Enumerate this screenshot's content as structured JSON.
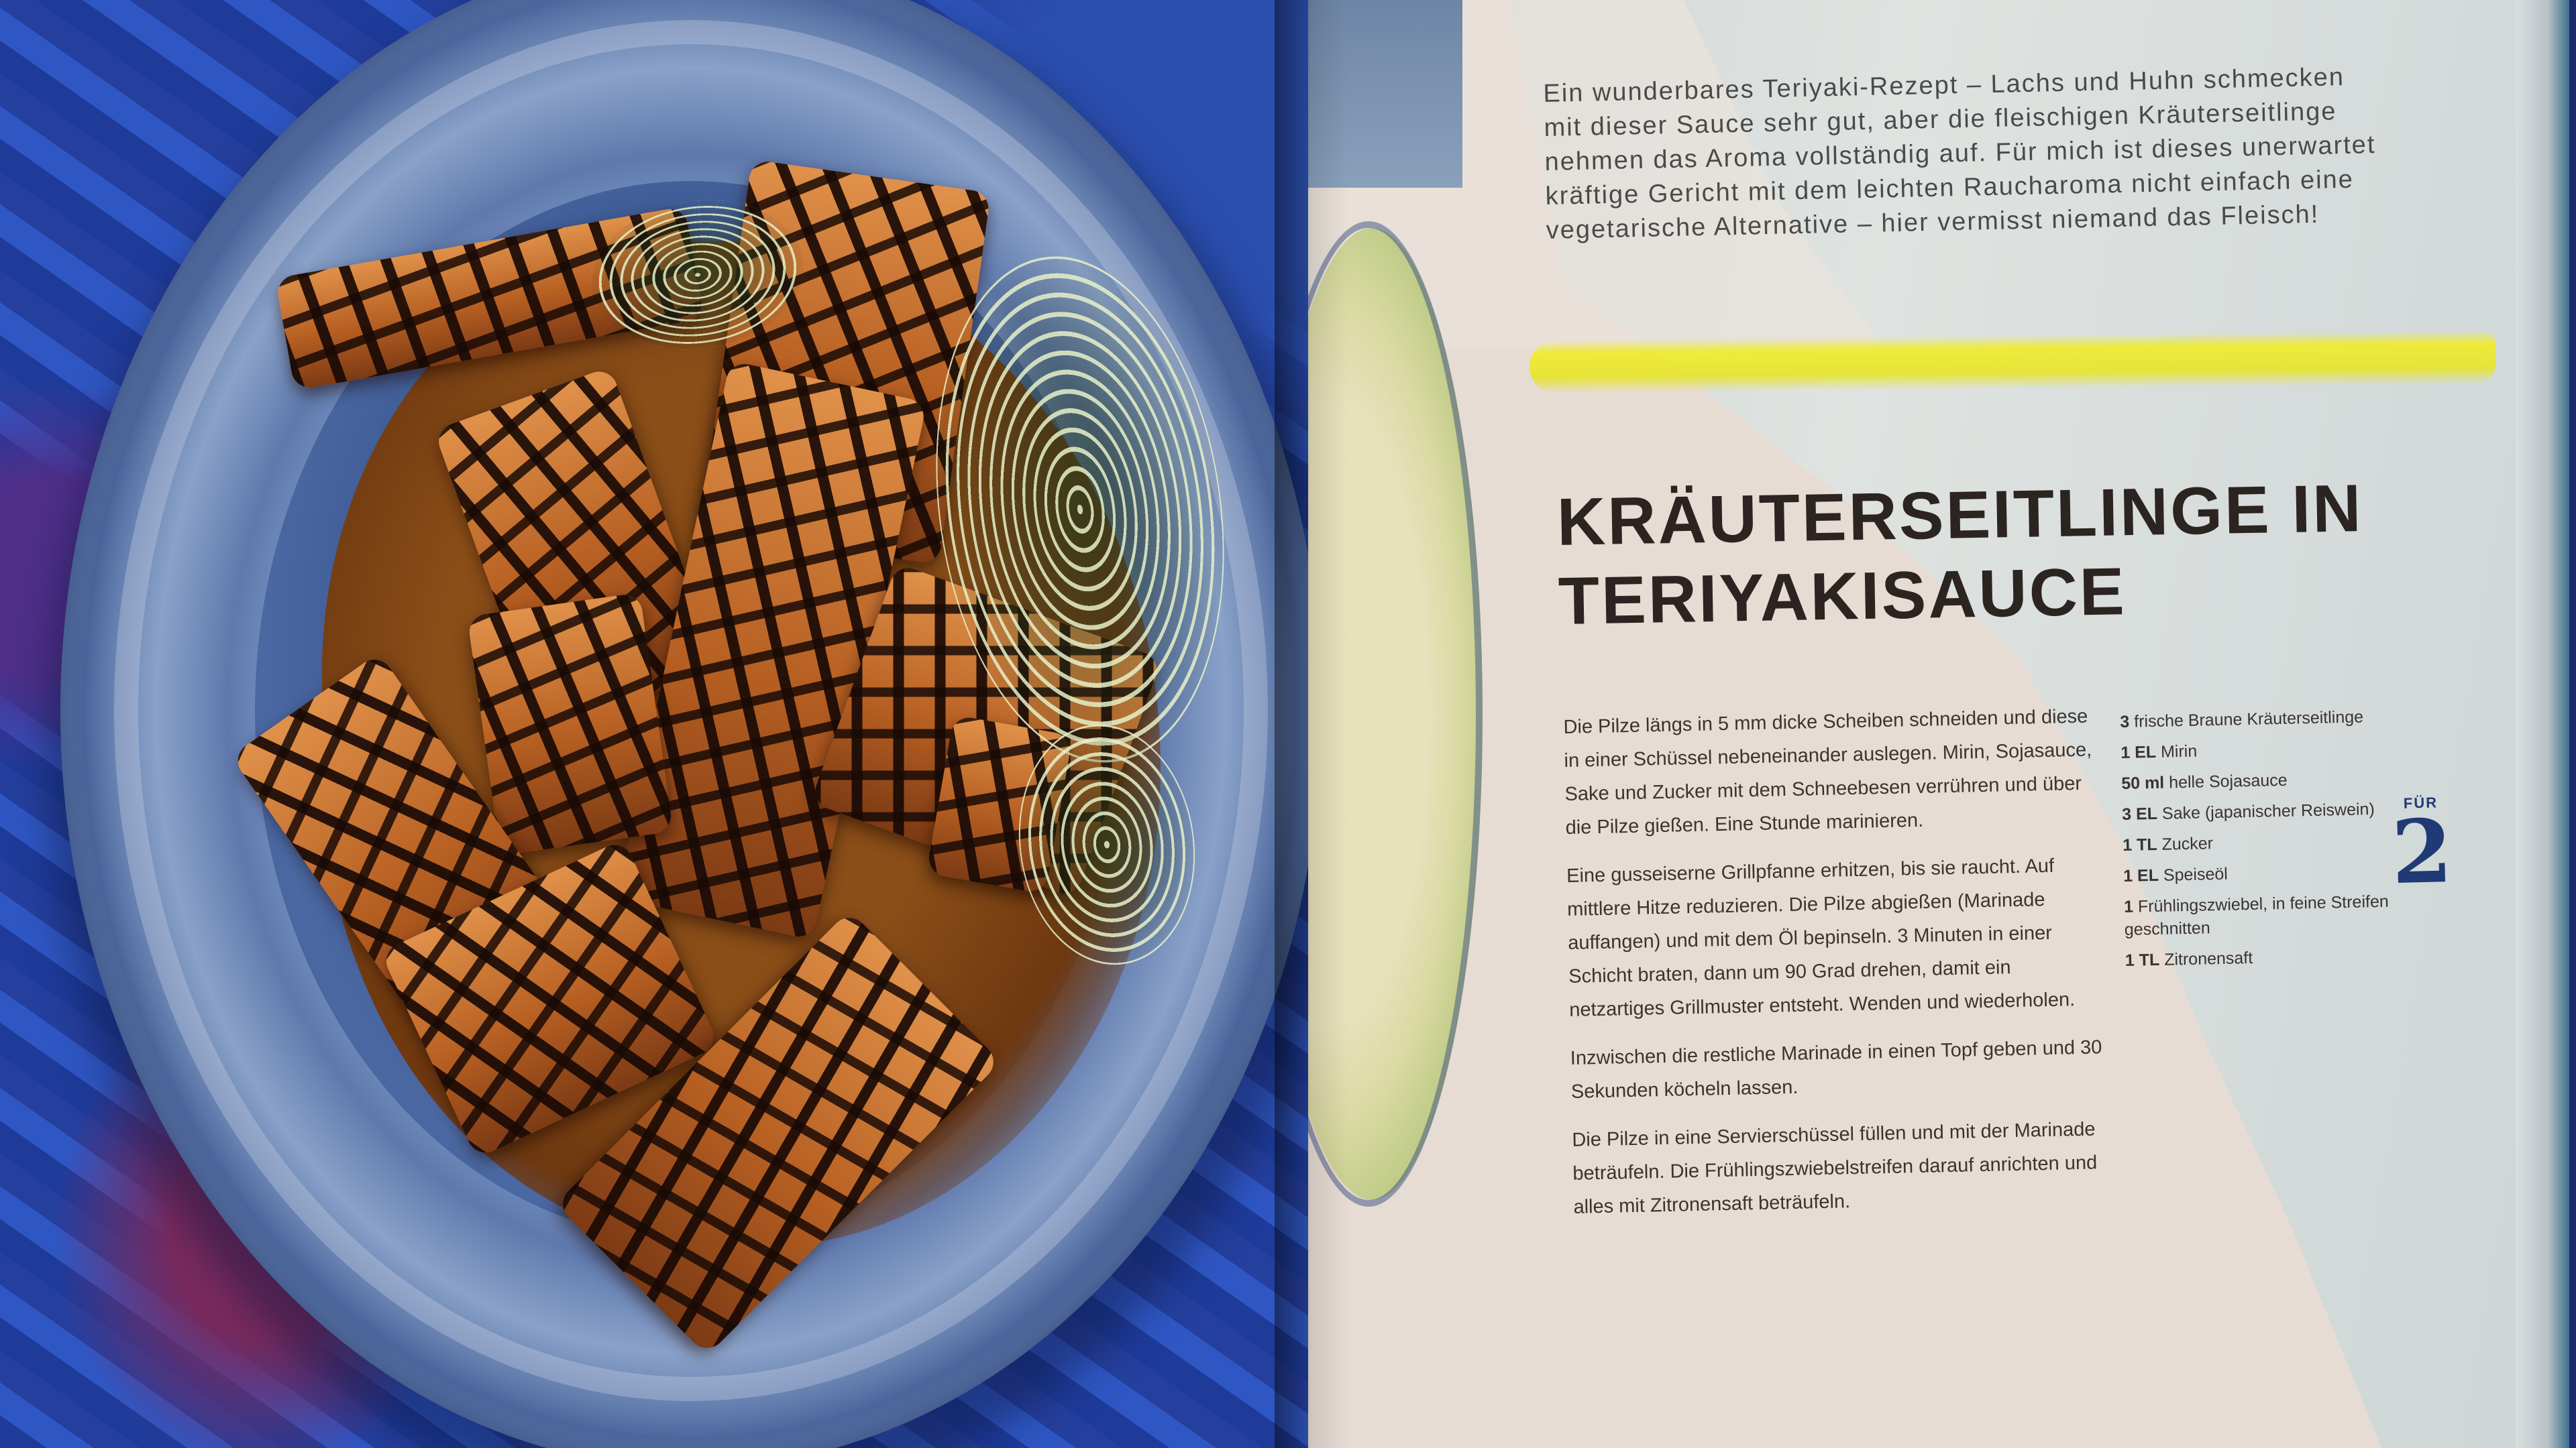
{
  "recipe": {
    "intro": "Ein wunderbares Teriyaki-Rezept – Lachs und Huhn schmecken mit dieser Sauce sehr gut, aber die fleischigen Kräuterseitlinge nehmen das Aroma vollständig auf. Für mich ist dieses unerwartet kräftige Gericht mit dem leichten Raucharoma nicht einfach eine vegetarische Alternative – hier vermisst niemand das Fleisch!",
    "title_line1": "KRÄUTERSEITLINGE IN",
    "title_line2": "TERIYAKISAUCE",
    "steps": [
      "Die Pilze längs in 5 mm dicke Scheiben schneiden und diese in einer Schüssel nebeneinander auslegen. Mirin, Sojasauce, Sake und Zucker mit dem Schneebesen verrühren und über die Pilze gießen. Eine Stunde marinieren.",
      "Eine gusseiserne Grillpfanne erhitzen, bis sie raucht. Auf mittlere Hitze reduzieren. Die Pilze abgießen (Marinade auffangen) und mit dem Öl bepinseln. 3 Minuten in einer Schicht braten, dann um 90 Grad drehen, damit ein netzartiges Grillmuster entsteht. Wenden und wiederholen.",
      "Inzwischen die restliche Marinade in einen Topf geben und 30 Sekunden köcheln lassen.",
      "Die Pilze in eine Servierschüssel füllen und mit der Marinade beträufeln. Die Frühlingszwiebelstreifen darauf anrichten und alles mit Zitronensaft beträufeln."
    ],
    "ingredients": [
      {
        "qty": "3",
        "item": "frische Braune Kräuterseitlinge"
      },
      {
        "qty": "1 EL",
        "item": "Mirin"
      },
      {
        "qty": "50 ml",
        "item": "helle Sojasauce"
      },
      {
        "qty": "3 EL",
        "item": "Sake (japanischer Reiswein)"
      },
      {
        "qty": "1 TL",
        "item": "Zucker"
      },
      {
        "qty": "1 EL",
        "item": "Speiseöl"
      },
      {
        "qty": "1",
        "item": "Frühlingszwiebel, in feine Streifen geschnitten"
      },
      {
        "qty": "1 TL",
        "item": "Zitronensaft"
      }
    ],
    "serves_label": "FÜR",
    "serves_count": "2"
  },
  "colors": {
    "highlight": "#f0ec28",
    "title": "#2b2420",
    "serves": "#1f3a74"
  }
}
